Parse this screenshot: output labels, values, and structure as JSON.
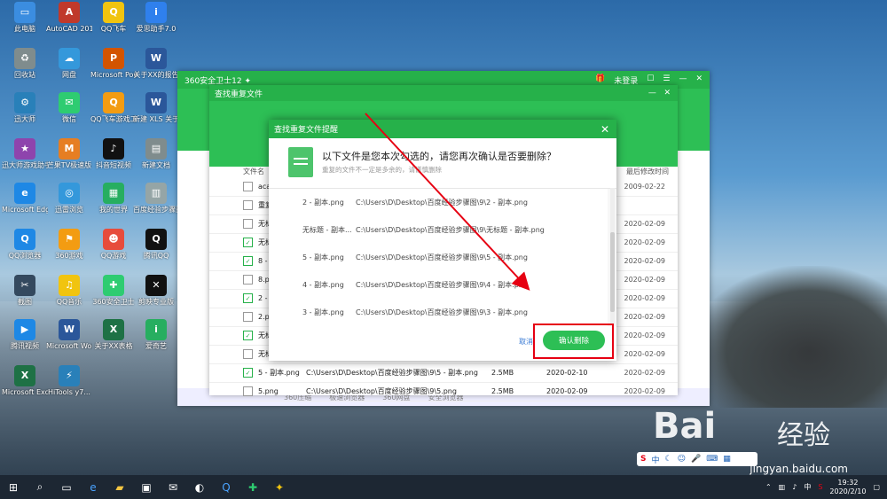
{
  "desktop_icons": [
    {
      "label": "此电脑",
      "color": "#3b8de0",
      "glyph": "▭"
    },
    {
      "label": "AutoCAD 2010 - S...",
      "color": "#c0392b",
      "glyph": "A"
    },
    {
      "label": "QQ飞车",
      "color": "#f1c40f",
      "glyph": "Q"
    },
    {
      "label": "爱思助手7.0",
      "color": "#2f80ed",
      "glyph": "i"
    },
    {
      "label": "回收站",
      "color": "#7f8c8d",
      "glyph": "♻"
    },
    {
      "label": "网盘",
      "color": "#3498db",
      "glyph": "☁"
    },
    {
      "label": "Microsoft PowerPoi...",
      "color": "#d35400",
      "glyph": "P"
    },
    {
      "label": "关于XX的报告",
      "color": "#2b579a",
      "glyph": "W"
    },
    {
      "label": "迅大师",
      "color": "#2980b9",
      "glyph": "⚙"
    },
    {
      "label": "微信",
      "color": "#2ecc71",
      "glyph": "✉"
    },
    {
      "label": "QQ飞车游戏工具",
      "color": "#f39c12",
      "glyph": "Q"
    },
    {
      "label": "新建 XLS 关于XX",
      "color": "#2b579a",
      "glyph": "W"
    },
    {
      "label": "迅大师游戏助手",
      "color": "#8e44ad",
      "glyph": "★"
    },
    {
      "label": "芒果TV极速版",
      "color": "#e67e22",
      "glyph": "M"
    },
    {
      "label": "抖音短视频",
      "color": "#111111",
      "glyph": "♪"
    },
    {
      "label": "新建文档",
      "color": "#7f8c8d",
      "glyph": "▤"
    },
    {
      "label": "Microsoft Edge",
      "color": "#1e88e5",
      "glyph": "e"
    },
    {
      "label": "迅雷浏览",
      "color": "#3498db",
      "glyph": "◎"
    },
    {
      "label": "我的世界",
      "color": "#27ae60",
      "glyph": "▦"
    },
    {
      "label": "百度经验步骤图",
      "color": "#95a5a6",
      "glyph": "▥"
    },
    {
      "label": "QQ浏览器",
      "color": "#1e88e5",
      "glyph": "Q"
    },
    {
      "label": "360游戏",
      "color": "#f39c12",
      "glyph": "⚑"
    },
    {
      "label": "QQ游戏",
      "color": "#e74c3c",
      "glyph": "☻"
    },
    {
      "label": "腾讯QQ",
      "color": "#111111",
      "glyph": "Q"
    },
    {
      "label": "截图",
      "color": "#34495e",
      "glyph": "✂"
    },
    {
      "label": "QQ音乐",
      "color": "#f1c40f",
      "glyph": "♫"
    },
    {
      "label": "360安全卫士",
      "color": "#2ecc71",
      "glyph": "✚"
    },
    {
      "label": "剪映专业版",
      "color": "#111111",
      "glyph": "✕"
    },
    {
      "label": "腾讯视频",
      "color": "#1e88e5",
      "glyph": "▶"
    },
    {
      "label": "Microsoft Word 2010",
      "color": "#2b579a",
      "glyph": "W"
    },
    {
      "label": "关于XX表格",
      "color": "#1e7145",
      "glyph": "X"
    },
    {
      "label": "爱奇艺",
      "color": "#27ae60",
      "glyph": "i"
    },
    {
      "label": "Microsoft Excel 2010",
      "color": "#1e7145",
      "glyph": "X"
    },
    {
      "label": "HiTools y7...",
      "color": "#2980b9",
      "glyph": "⚡"
    }
  ],
  "win360": {
    "title": "360安全卫士12 ✦",
    "user": "未登录",
    "bottom": [
      "360压缩",
      "极速浏览器",
      "360网盘",
      "安全浏览器"
    ]
  },
  "dupwin": {
    "title": "查找重复文件",
    "col_name": "文件名",
    "col_date": "最后修改时间",
    "rows": [
      {
        "name": "acad",
        "date": "2009-02-22",
        "checked": false
      },
      {
        "name": "重复图片",
        "date": "",
        "checked": false
      },
      {
        "name": "无标题",
        "date": "2020-02-09",
        "checked": false
      },
      {
        "name": "无标题",
        "date": "2020-02-09",
        "checked": true
      },
      {
        "name": "8 - ",
        "date": "2020-02-09",
        "checked": true
      },
      {
        "name": "8.png",
        "date": "2020-02-09",
        "checked": false
      },
      {
        "name": "2 - ",
        "date": "2020-02-09",
        "checked": true
      },
      {
        "name": "2.png",
        "date": "2020-02-09",
        "checked": false
      },
      {
        "name": "无标题",
        "date": "2020-02-09",
        "checked": true
      },
      {
        "name": "无标题",
        "date": "2020-02-09",
        "checked": false
      },
      {
        "name": "5 - 副本.png",
        "date": "2020-02-10",
        "checked": true
      },
      {
        "name": "5.png",
        "date": "2020-02-09",
        "checked": false
      }
    ],
    "row5_path": "C:\\Users\\D\\Desktop\\百度经验步骤图\\9\\5 - 副本.png",
    "row5_size": "2.5MB",
    "row5_date": "2020-02-10",
    "row6_path": "C:\\Users\\D\\Desktop\\百度经验步骤图\\9\\5.png",
    "row6_size": "2.5MB",
    "row6_date": "2020-02-09",
    "row6_date2": "2020-02-09"
  },
  "dialog": {
    "title": "查找重复文件提醒",
    "heading": "以下文件是您本次勾选的，请您再次确认是否要删除？",
    "subtext": "重复的文件不一定是多余的，请谨慎删除",
    "files": [
      {
        "name": "2 - 副本.png",
        "path": "C:\\Users\\D\\Desktop\\百度经验步骤图\\9\\2 - 副本.png"
      },
      {
        "name": "无标题 - 副本...",
        "path": "C:\\Users\\D\\Desktop\\百度经验步骤图\\9\\无标题 - 副本.png"
      },
      {
        "name": "5 - 副本.png",
        "path": "C:\\Users\\D\\Desktop\\百度经验步骤图\\9\\5 - 副本.png"
      },
      {
        "name": "4 - 副本.png",
        "path": "C:\\Users\\D\\Desktop\\百度经验步骤图\\9\\4 - 副本.png"
      },
      {
        "name": "3 - 副本.png",
        "path": "C:\\Users\\D\\Desktop\\百度经验步骤图\\9\\3 - 副本.png"
      }
    ],
    "cancel": "取消",
    "confirm": "确认删除"
  },
  "ime": {
    "s": "S",
    "lang": "中"
  },
  "watermark": {
    "brand": "Bai",
    "jy": "经验",
    "url": "jingyan.baidu.com"
  },
  "taskbar": {
    "time": "19:32",
    "date": "2020/2/10",
    "lang": "中"
  },
  "colors": {
    "green": "#2dbf55",
    "red_box": "#e60012",
    "arrow": "#e60012"
  }
}
